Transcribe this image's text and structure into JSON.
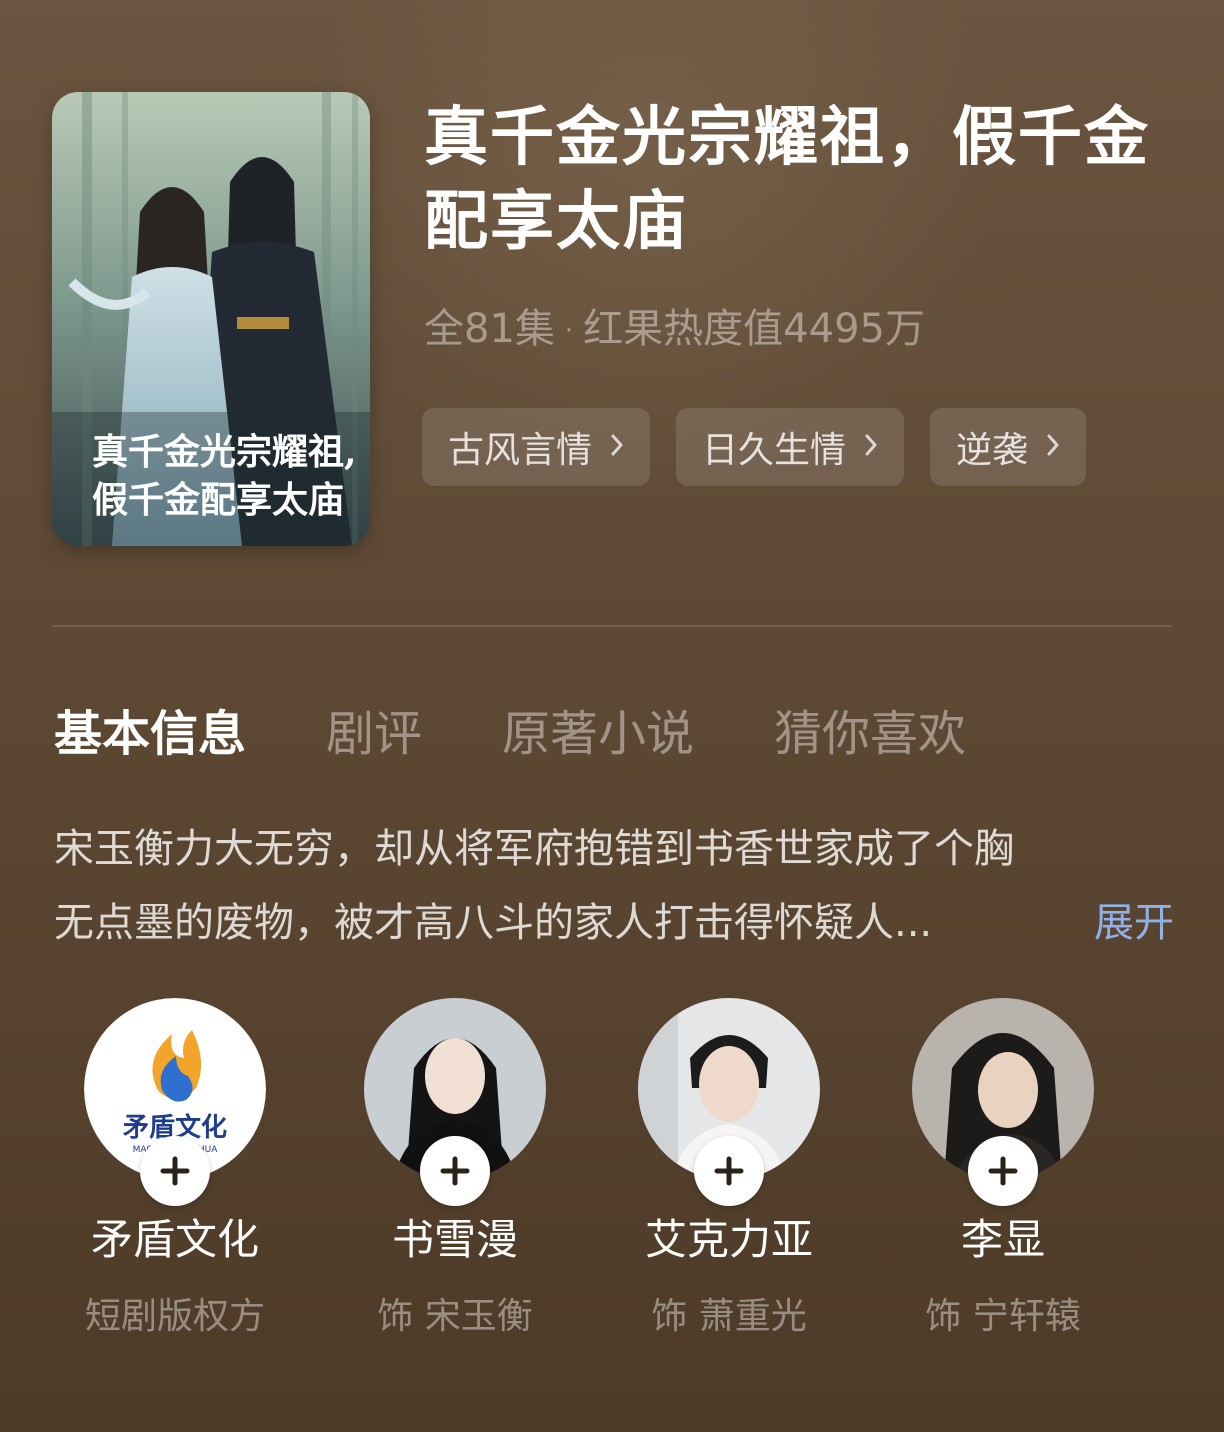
{
  "drama": {
    "title_line1": "真千金光宗耀祖，假千金",
    "title_line2": "配享太庙",
    "episodes": "全81集",
    "separator": "·",
    "heat": "红果热度值4495万",
    "poster_calligraphy": "真千金光宗耀祖，假千金配享太庙"
  },
  "tags": [
    {
      "label": "古风言情"
    },
    {
      "label": "日久生情"
    },
    {
      "label": "逆袭"
    }
  ],
  "tabs": [
    {
      "label": "基本信息",
      "active": true
    },
    {
      "label": "剧评",
      "active": false
    },
    {
      "label": "原著小说",
      "active": false
    },
    {
      "label": "猜你喜欢",
      "active": false
    }
  ],
  "synopsis": {
    "line1": "宋玉衡力大无穷，却从将军府抱错到书香世家成了个胸",
    "line2": "无点墨的废物，被才高八斗的家人打击得怀疑人...",
    "expand_label": "展开"
  },
  "people": [
    {
      "name": "矛盾文化",
      "role": "短剧版权方",
      "logo_text": "矛盾文化",
      "logo_sub": "MAODUN WENHUA"
    },
    {
      "name": "书雪漫",
      "role": "饰 宋玉衡"
    },
    {
      "name": "艾克力亚",
      "role": "饰 萧重光"
    },
    {
      "name": "李显",
      "role": "饰 宁轩辕"
    }
  ],
  "colors": {
    "background_top": "#6b5540",
    "background_bottom": "#4d3a27",
    "expand_link": "#8fb0e8"
  },
  "icons": [
    "chevron-right-icon",
    "plus-icon",
    "flame-logo-icon"
  ]
}
